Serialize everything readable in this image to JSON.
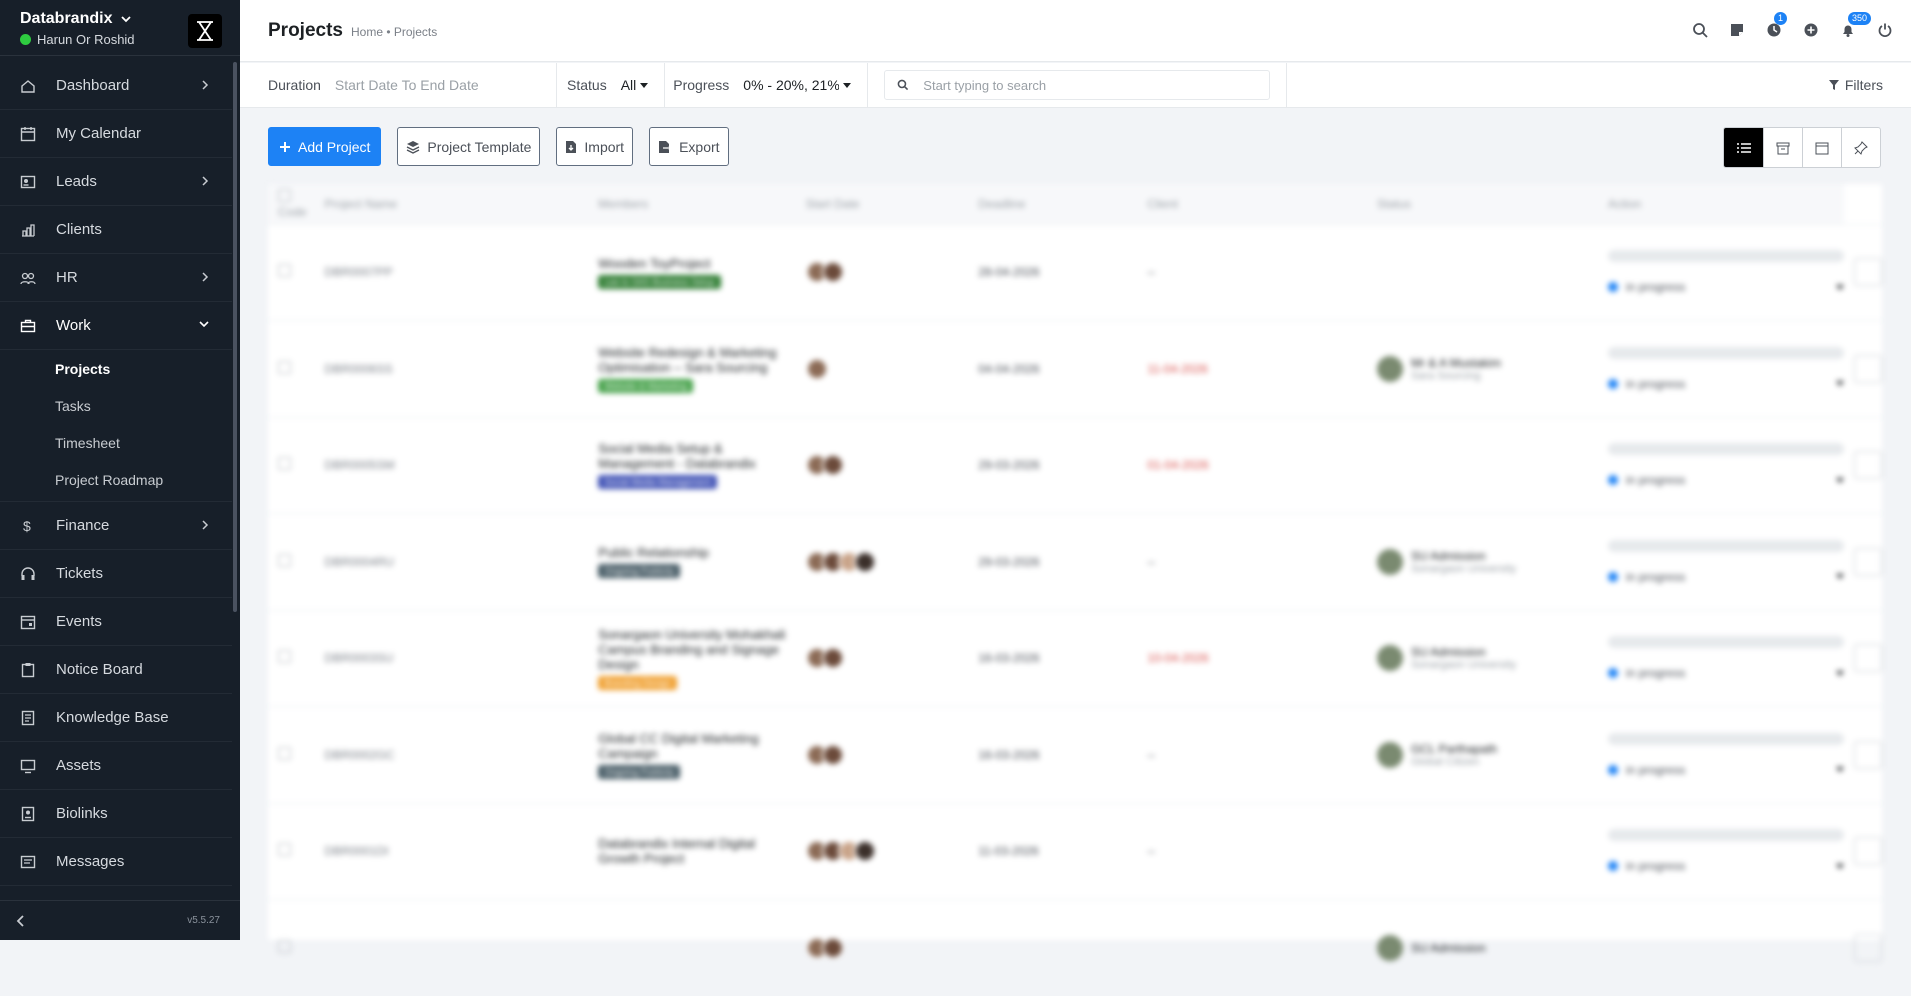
{
  "sidebar": {
    "workspace": "Databrandix",
    "user": "Harun Or Roshid",
    "version": "v5.5.27",
    "items": [
      {
        "label": "Dashboard",
        "icon": "house-icon",
        "chevron": "right"
      },
      {
        "label": "My Calendar",
        "icon": "calendar-icon",
        "chevron": ""
      },
      {
        "label": "Leads",
        "icon": "id-card-icon",
        "chevron": "right"
      },
      {
        "label": "Clients",
        "icon": "chart-icon",
        "chevron": ""
      },
      {
        "label": "HR",
        "icon": "people-icon",
        "chevron": "right"
      },
      {
        "label": "Work",
        "icon": "briefcase-icon",
        "chevron": "down"
      },
      {
        "label": "Finance",
        "icon": "dollar-icon",
        "chevron": "right"
      },
      {
        "label": "Tickets",
        "icon": "headset-icon",
        "chevron": ""
      },
      {
        "label": "Events",
        "icon": "calendar-event-icon",
        "chevron": ""
      },
      {
        "label": "Notice Board",
        "icon": "clipboard-icon",
        "chevron": ""
      },
      {
        "label": "Knowledge Base",
        "icon": "book-icon",
        "chevron": ""
      },
      {
        "label": "Assets",
        "icon": "monitor-icon",
        "chevron": ""
      },
      {
        "label": "Biolinks",
        "icon": "profile-card-icon",
        "chevron": ""
      },
      {
        "label": "Messages",
        "icon": "message-icon",
        "chevron": ""
      }
    ],
    "work_sub": [
      "Projects",
      "Tasks",
      "Timesheet",
      "Project Roadmap"
    ]
  },
  "header": {
    "title": "Projects",
    "breadcrumb": "Home • Projects",
    "badges": {
      "timer": "1",
      "notifications": "350"
    }
  },
  "filters": {
    "duration_label": "Duration",
    "duration_value": "Start Date To End Date",
    "status_label": "Status",
    "status_value": "All",
    "progress_label": "Progress",
    "progress_value": "0% - 20%, 21%",
    "search_placeholder": "Start typing to search",
    "filters_label": "Filters"
  },
  "actions": {
    "add": "Add Project",
    "template": "Project Template",
    "import": "Import",
    "export": "Export"
  },
  "table": {
    "headers": [
      "Code",
      "Project Name",
      "Members",
      "Start Date",
      "Deadline",
      "Client",
      "Status",
      "Action"
    ],
    "rows": [
      {
        "code": "DBR0007PP",
        "name": "Wooden ToyProject",
        "tag": "Lee to SAS Business Setup",
        "tag_color": "#2e7d32",
        "members": 2,
        "start": "28-04-2026",
        "deadline": "--",
        "deadline_red": false,
        "client_name": "",
        "client_org": "",
        "status": "in progress"
      },
      {
        "code": "DBR0006SS",
        "name": "Website Redesign & Marketing Optimisation – Sara Sourcing",
        "tag": "Website & Marketing",
        "tag_color": "#43a047",
        "members": 1,
        "start": "04-04-2026",
        "deadline": "11-04-2026",
        "deadline_red": true,
        "client_name": "Mr & A Mustakim",
        "client_org": "Sara Sourcing",
        "status": "in progress"
      },
      {
        "code": "DBR0005SM",
        "name": "Social Media Setup & Management - Databrandix",
        "tag": "Social Media Management",
        "tag_color": "#3f51b5",
        "members": 2,
        "start": "29-03-2026",
        "deadline": "01-04-2026",
        "deadline_red": true,
        "client_name": "",
        "client_org": "",
        "status": "in progress"
      },
      {
        "code": "DBR0004RU",
        "name": "Public Relationship",
        "tag": "Ongoing Publicity",
        "tag_color": "#455a64",
        "members": 4,
        "start": "29-03-2026",
        "deadline": "--",
        "deadline_red": false,
        "client_name": "SU Admission",
        "client_org": "Sonargaon University",
        "status": "in progress"
      },
      {
        "code": "DBR0003SU",
        "name": "Sonargaon University Mohakhali Campus Branding and Signage Design",
        "tag": "Branding Design",
        "tag_color": "#f0a030",
        "members": 2,
        "start": "16-03-2026",
        "deadline": "10-04-2026",
        "deadline_red": true,
        "client_name": "SU Admission",
        "client_org": "Sonargaon University",
        "status": "in progress"
      },
      {
        "code": "DBR0002GC",
        "name": "Global CC Digital Marketing Campaign",
        "tag": "Ongoing Publicity",
        "tag_color": "#455a64",
        "members": 2,
        "start": "16-03-2026",
        "deadline": "--",
        "deadline_red": false,
        "client_name": "GCL Parthapath",
        "client_org": "Global Citizen",
        "status": "in progress"
      },
      {
        "code": "DBR0001DI",
        "name": "Databrandix Internal Digital Growth Project",
        "tag": "",
        "tag_color": "",
        "members": 4,
        "start": "11-03-2026",
        "deadline": "--",
        "deadline_red": false,
        "client_name": "",
        "client_org": "",
        "status": "in progress"
      },
      {
        "code": "",
        "name": "",
        "tag": "",
        "tag_color": "",
        "members": 2,
        "start": "",
        "deadline": "",
        "deadline_red": false,
        "client_name": "SU Admission",
        "client_org": "",
        "status": ""
      }
    ]
  },
  "colors": {
    "accent": "#1d82f5",
    "sidebar_bg": "#171f29",
    "online": "#2ecc40"
  }
}
